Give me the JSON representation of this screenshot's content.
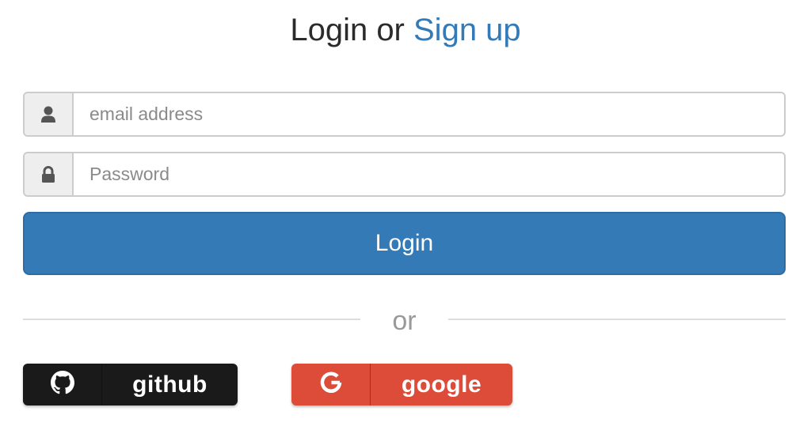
{
  "header": {
    "login_text": "Login or ",
    "signup_text": "Sign up"
  },
  "form": {
    "email": {
      "placeholder": "email address",
      "value": "",
      "icon": "user-icon"
    },
    "password": {
      "placeholder": "Password",
      "value": "",
      "icon": "lock-icon"
    },
    "login_label": "Login"
  },
  "divider": {
    "text": "or"
  },
  "social": {
    "github": {
      "label": "github",
      "icon": "github-icon",
      "color": "#1a1a1a"
    },
    "google": {
      "label": "google",
      "icon": "google-icon",
      "color": "#dd4b39"
    }
  },
  "colors": {
    "primary": "#337ab7",
    "text": "#2b2b2b",
    "muted": "#999999"
  }
}
